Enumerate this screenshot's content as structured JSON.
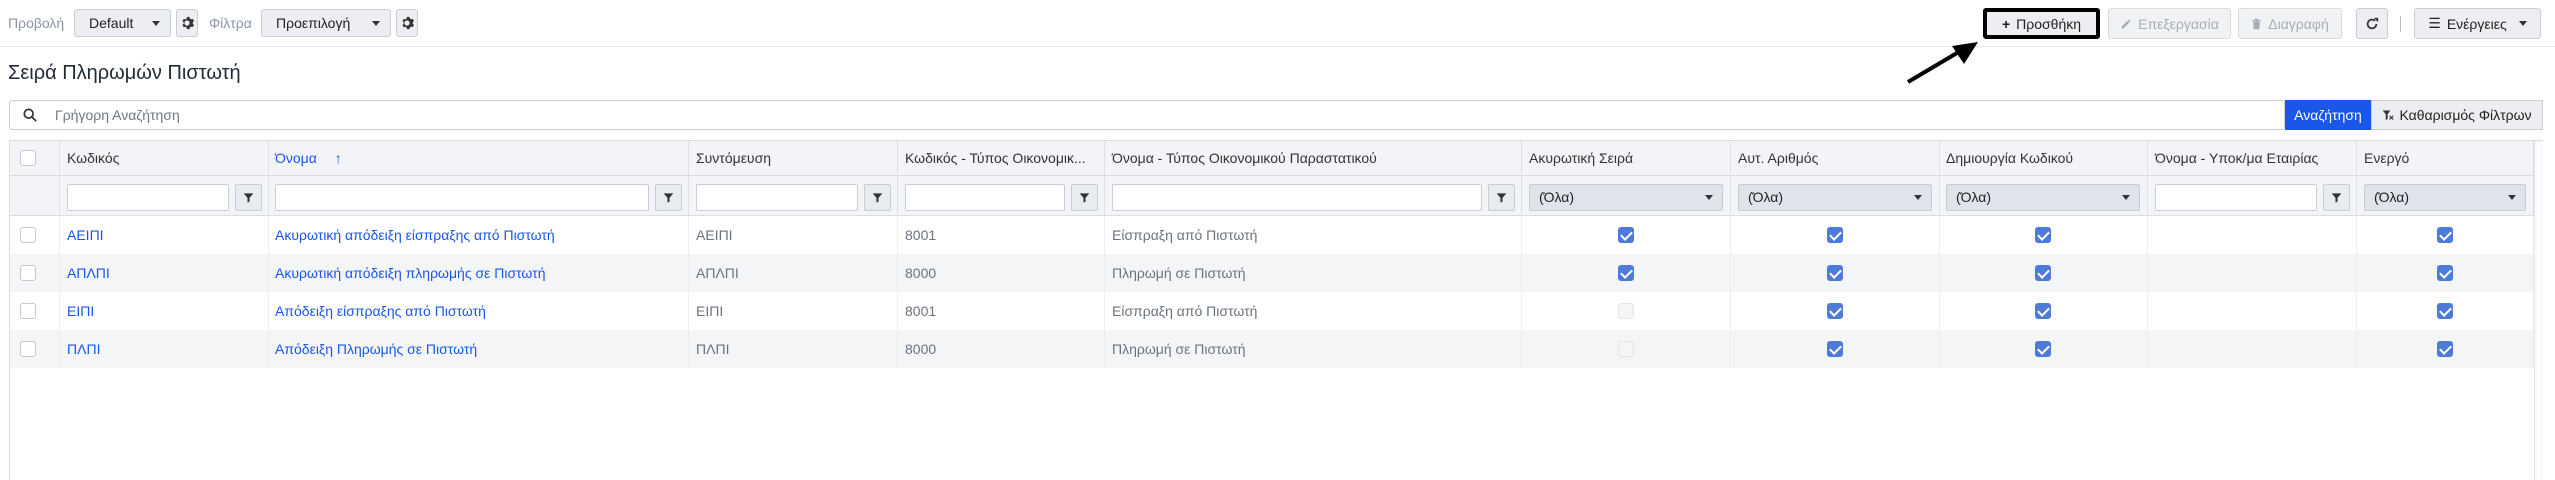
{
  "toolbar": {
    "view_label": "Προβολή",
    "view_value": "Default",
    "filter_label": "Φίλτρα",
    "filter_value": "Προεπιλογή",
    "add_label": "Προσθήκη",
    "edit_label": "Επεξεργασία",
    "delete_label": "Διαγραφή",
    "actions_label": "Ενέργειες"
  },
  "page": {
    "title": "Σειρά Πληρωμών Πιστωτή"
  },
  "search": {
    "placeholder": "Γρήγορη Αναζήτηση",
    "search_button": "Αναζήτηση",
    "clear_button": "Καθαρισμός Φίλτρων"
  },
  "table": {
    "columns": [
      "Κωδικός",
      "Όνομα",
      "Συντόμευση",
      "Κωδικός - Τύπος Οικονομικ...",
      "Όνομα - Τύπος Οικονομικού Παραστατικού",
      "Ακυρωτική Σειρά",
      "Αυτ. Αριθμός",
      "Δημιουργία Κωδικού",
      "Όνομα - Υποκ/μα Εταιρίας",
      "Ενεργό"
    ],
    "sort_column": "Όνομα",
    "sort_direction": "ascending",
    "filter_all_option": "(Όλα)",
    "rows": [
      {
        "code": "ΑΕΙΠΙ",
        "name": "Ακυρωτική απόδειξη είσπραξης από Πιστωτή",
        "abbr": "ΑΕΙΠΙ",
        "doc_code": "8001",
        "doc_name": "Είσπραξη από Πιστωτή",
        "cancel": true,
        "auto_num": true,
        "create_code": true,
        "subsidiary": "",
        "active": true
      },
      {
        "code": "ΑΠΛΠΙ",
        "name": "Ακυρωτική απόδειξη πληρωμής σε Πιστωτή",
        "abbr": "ΑΠΛΠΙ",
        "doc_code": "8000",
        "doc_name": "Πληρωμή σε Πιστωτή",
        "cancel": true,
        "auto_num": true,
        "create_code": true,
        "subsidiary": "",
        "active": true
      },
      {
        "code": "ΕΙΠΙ",
        "name": "Απόδειξη είσπραξης από Πιστωτή",
        "abbr": "ΕΙΠΙ",
        "doc_code": "8001",
        "doc_name": "Είσπραξη από Πιστωτή",
        "cancel": false,
        "auto_num": true,
        "create_code": true,
        "subsidiary": "",
        "active": true
      },
      {
        "code": "ΠΛΠΙ",
        "name": "Απόδειξη Πληρωμής σε Πιστωτή",
        "abbr": "ΠΛΠΙ",
        "doc_code": "8000",
        "doc_name": "Πληρωμή σε Πιστωτή",
        "cancel": false,
        "auto_num": true,
        "create_code": true,
        "subsidiary": "",
        "active": true
      }
    ]
  },
  "colors": {
    "accent": "#1a56e8",
    "checkbox_on": "#4e7bd9"
  }
}
